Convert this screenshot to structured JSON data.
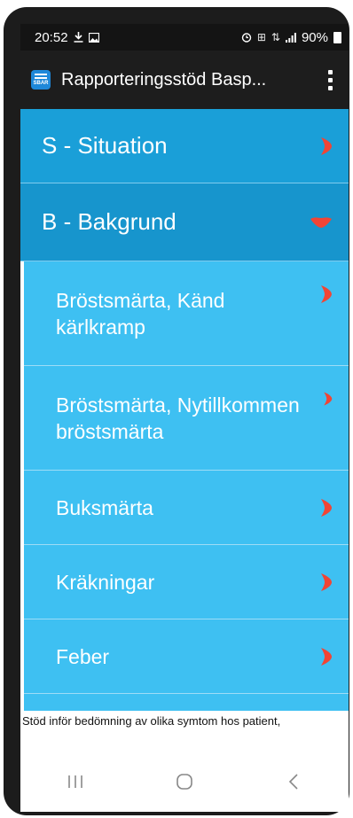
{
  "status_bar": {
    "time": "20:52",
    "left_icons": [
      "download-icon",
      "image-icon"
    ],
    "right_icons": [
      "alarm-icon",
      "volte-icon",
      "4g-icon",
      "signal-icon"
    ],
    "battery": "90%"
  },
  "app_bar": {
    "icon_text": "SBAR",
    "title": "Rapporteringsstöd Basp..."
  },
  "colors": {
    "header_bg": "#1a9fd8",
    "item_bg": "#3ec0f2",
    "chevron": "#f04535"
  },
  "sections": [
    {
      "label": "S - Situation",
      "state": "collapsed"
    },
    {
      "label": "B - Bakgrund",
      "state": "expanded"
    }
  ],
  "items": [
    {
      "label": "Bröstsmärta, Känd kärlkramp"
    },
    {
      "label": "Bröstsmärta, Nytillkommen bröstsmärta"
    },
    {
      "label": "Buksmärta"
    },
    {
      "label": "Kräkningar"
    },
    {
      "label": "Feber"
    }
  ],
  "footer": {
    "text": "Stöd inför bedömning av olika symtom hos patient,"
  },
  "nav": {
    "recents": "recents-icon",
    "home": "home-icon",
    "back": "back-icon"
  }
}
